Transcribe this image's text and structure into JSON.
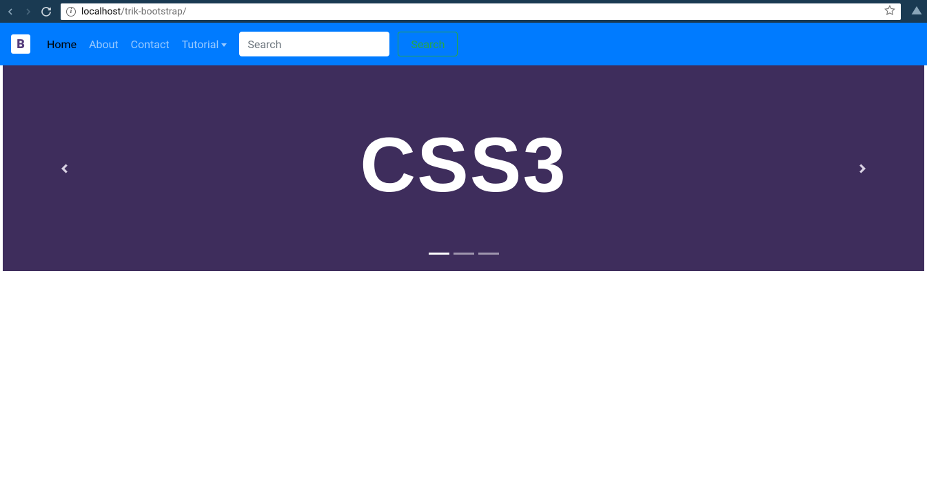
{
  "browser": {
    "url_host": "localhost",
    "url_path": "/trik-bootstrap/"
  },
  "navbar": {
    "brand": "B",
    "links": {
      "home": "Home",
      "about": "About",
      "contact": "Contact",
      "tutorial": "Tutorial"
    },
    "search_placeholder": "Search",
    "search_button": "Search"
  },
  "carousel": {
    "slide_text": "CSS3",
    "active_index": 0,
    "total_slides": 3
  }
}
